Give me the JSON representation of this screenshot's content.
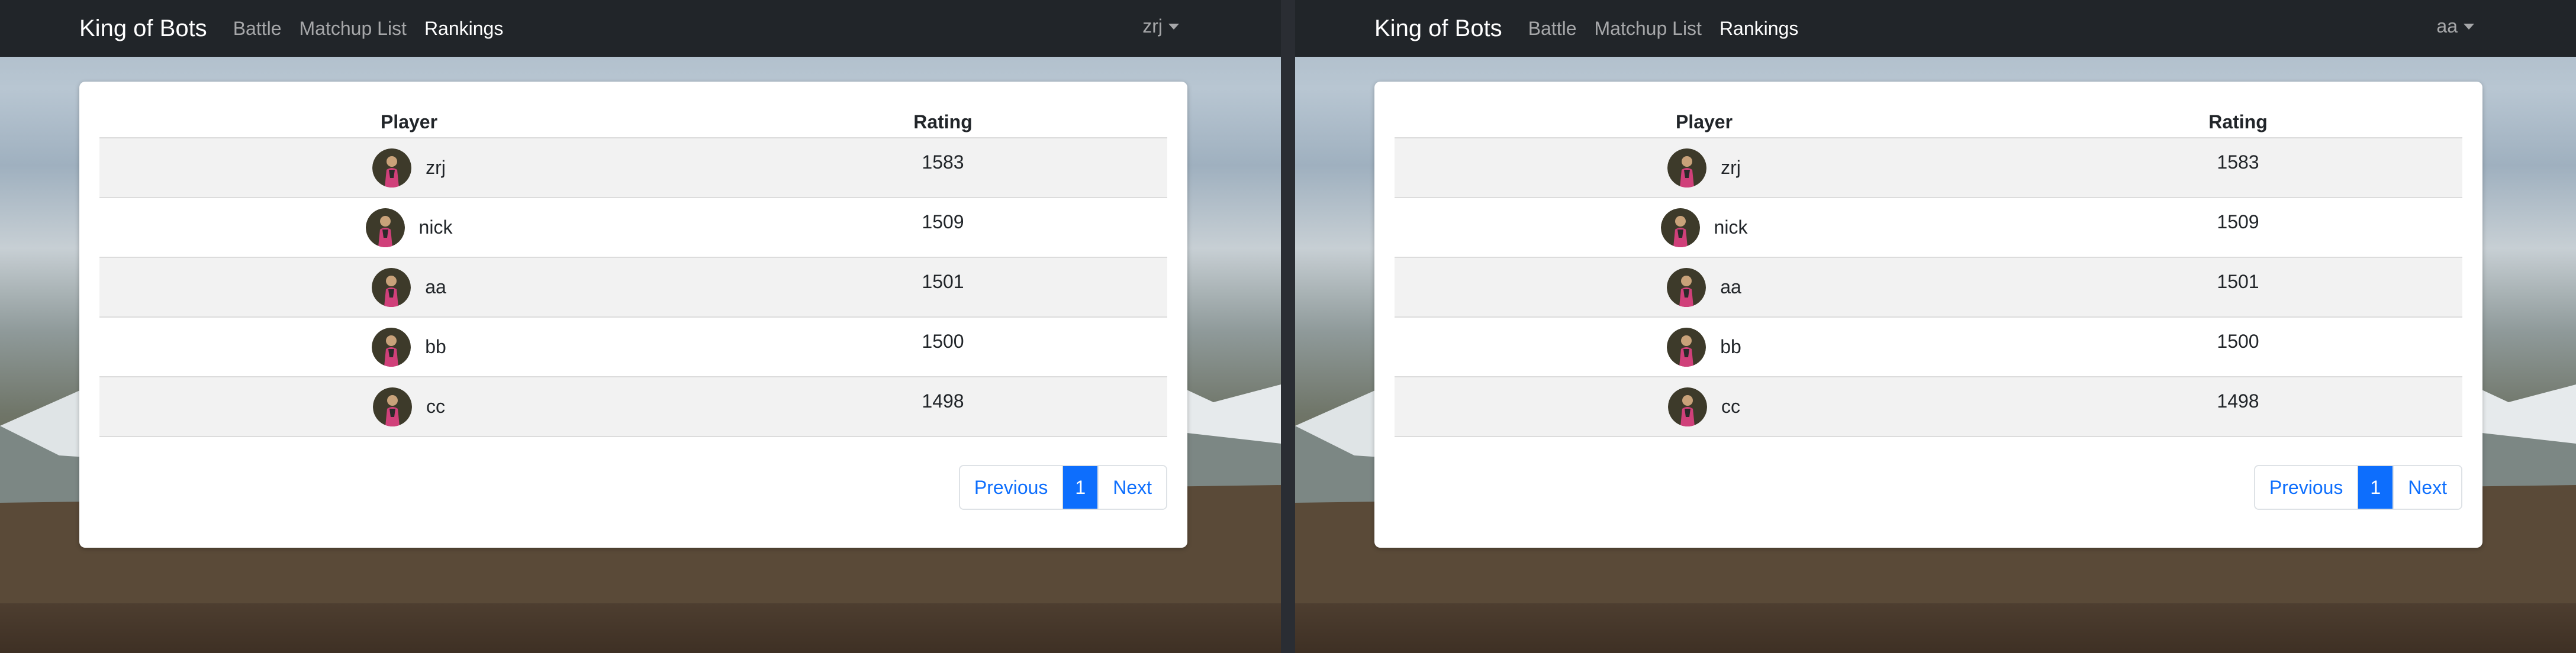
{
  "colors": {
    "navbar": "#212529",
    "link_blue": "#0d6efd",
    "active_page": "#0d6efd"
  },
  "windows": [
    {
      "brand": "King of Bots",
      "nav": [
        "Battle",
        "Matchup List",
        "Rankings"
      ],
      "active_nav": "Rankings",
      "user": "zrj",
      "table": {
        "headers": {
          "player": "Player",
          "rating": "Rating"
        },
        "rows": [
          {
            "name": "zrj",
            "rating": "1583"
          },
          {
            "name": "nick",
            "rating": "1509"
          },
          {
            "name": "aa",
            "rating": "1501"
          },
          {
            "name": "bb",
            "rating": "1500"
          },
          {
            "name": "cc",
            "rating": "1498"
          }
        ]
      },
      "pagination": {
        "previous": "Previous",
        "current": "1",
        "next": "Next"
      }
    },
    {
      "brand": "King of Bots",
      "nav": [
        "Battle",
        "Matchup List",
        "Rankings"
      ],
      "active_nav": "Rankings",
      "user": "aa",
      "table": {
        "headers": {
          "player": "Player",
          "rating": "Rating"
        },
        "rows": [
          {
            "name": "zrj",
            "rating": "1583"
          },
          {
            "name": "nick",
            "rating": "1509"
          },
          {
            "name": "aa",
            "rating": "1501"
          },
          {
            "name": "bb",
            "rating": "1500"
          },
          {
            "name": "cc",
            "rating": "1498"
          }
        ]
      },
      "pagination": {
        "previous": "Previous",
        "current": "1",
        "next": "Next"
      }
    }
  ]
}
